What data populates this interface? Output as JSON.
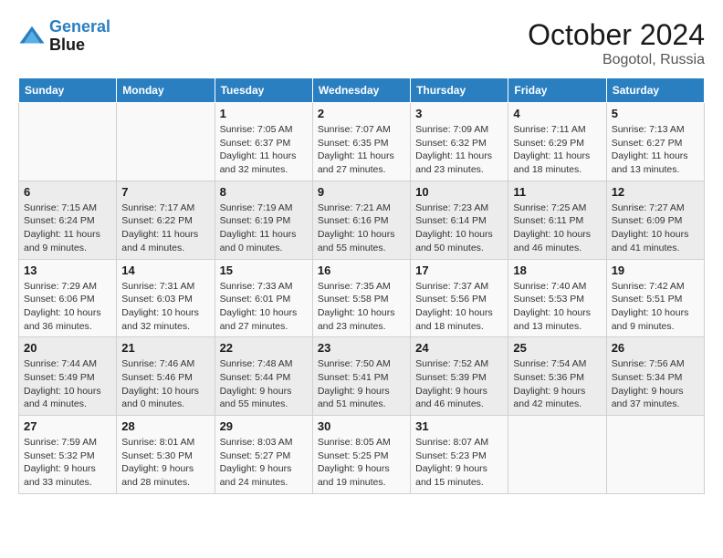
{
  "header": {
    "logo_line1": "General",
    "logo_line2": "Blue",
    "month": "October 2024",
    "location": "Bogotol, Russia"
  },
  "weekdays": [
    "Sunday",
    "Monday",
    "Tuesday",
    "Wednesday",
    "Thursday",
    "Friday",
    "Saturday"
  ],
  "weeks": [
    [
      {
        "day": "",
        "info": ""
      },
      {
        "day": "",
        "info": ""
      },
      {
        "day": "1",
        "info": "Sunrise: 7:05 AM\nSunset: 6:37 PM\nDaylight: 11 hours and 32 minutes."
      },
      {
        "day": "2",
        "info": "Sunrise: 7:07 AM\nSunset: 6:35 PM\nDaylight: 11 hours and 27 minutes."
      },
      {
        "day": "3",
        "info": "Sunrise: 7:09 AM\nSunset: 6:32 PM\nDaylight: 11 hours and 23 minutes."
      },
      {
        "day": "4",
        "info": "Sunrise: 7:11 AM\nSunset: 6:29 PM\nDaylight: 11 hours and 18 minutes."
      },
      {
        "day": "5",
        "info": "Sunrise: 7:13 AM\nSunset: 6:27 PM\nDaylight: 11 hours and 13 minutes."
      }
    ],
    [
      {
        "day": "6",
        "info": "Sunrise: 7:15 AM\nSunset: 6:24 PM\nDaylight: 11 hours and 9 minutes."
      },
      {
        "day": "7",
        "info": "Sunrise: 7:17 AM\nSunset: 6:22 PM\nDaylight: 11 hours and 4 minutes."
      },
      {
        "day": "8",
        "info": "Sunrise: 7:19 AM\nSunset: 6:19 PM\nDaylight: 11 hours and 0 minutes."
      },
      {
        "day": "9",
        "info": "Sunrise: 7:21 AM\nSunset: 6:16 PM\nDaylight: 10 hours and 55 minutes."
      },
      {
        "day": "10",
        "info": "Sunrise: 7:23 AM\nSunset: 6:14 PM\nDaylight: 10 hours and 50 minutes."
      },
      {
        "day": "11",
        "info": "Sunrise: 7:25 AM\nSunset: 6:11 PM\nDaylight: 10 hours and 46 minutes."
      },
      {
        "day": "12",
        "info": "Sunrise: 7:27 AM\nSunset: 6:09 PM\nDaylight: 10 hours and 41 minutes."
      }
    ],
    [
      {
        "day": "13",
        "info": "Sunrise: 7:29 AM\nSunset: 6:06 PM\nDaylight: 10 hours and 36 minutes."
      },
      {
        "day": "14",
        "info": "Sunrise: 7:31 AM\nSunset: 6:03 PM\nDaylight: 10 hours and 32 minutes."
      },
      {
        "day": "15",
        "info": "Sunrise: 7:33 AM\nSunset: 6:01 PM\nDaylight: 10 hours and 27 minutes."
      },
      {
        "day": "16",
        "info": "Sunrise: 7:35 AM\nSunset: 5:58 PM\nDaylight: 10 hours and 23 minutes."
      },
      {
        "day": "17",
        "info": "Sunrise: 7:37 AM\nSunset: 5:56 PM\nDaylight: 10 hours and 18 minutes."
      },
      {
        "day": "18",
        "info": "Sunrise: 7:40 AM\nSunset: 5:53 PM\nDaylight: 10 hours and 13 minutes."
      },
      {
        "day": "19",
        "info": "Sunrise: 7:42 AM\nSunset: 5:51 PM\nDaylight: 10 hours and 9 minutes."
      }
    ],
    [
      {
        "day": "20",
        "info": "Sunrise: 7:44 AM\nSunset: 5:49 PM\nDaylight: 10 hours and 4 minutes."
      },
      {
        "day": "21",
        "info": "Sunrise: 7:46 AM\nSunset: 5:46 PM\nDaylight: 10 hours and 0 minutes."
      },
      {
        "day": "22",
        "info": "Sunrise: 7:48 AM\nSunset: 5:44 PM\nDaylight: 9 hours and 55 minutes."
      },
      {
        "day": "23",
        "info": "Sunrise: 7:50 AM\nSunset: 5:41 PM\nDaylight: 9 hours and 51 minutes."
      },
      {
        "day": "24",
        "info": "Sunrise: 7:52 AM\nSunset: 5:39 PM\nDaylight: 9 hours and 46 minutes."
      },
      {
        "day": "25",
        "info": "Sunrise: 7:54 AM\nSunset: 5:36 PM\nDaylight: 9 hours and 42 minutes."
      },
      {
        "day": "26",
        "info": "Sunrise: 7:56 AM\nSunset: 5:34 PM\nDaylight: 9 hours and 37 minutes."
      }
    ],
    [
      {
        "day": "27",
        "info": "Sunrise: 7:59 AM\nSunset: 5:32 PM\nDaylight: 9 hours and 33 minutes."
      },
      {
        "day": "28",
        "info": "Sunrise: 8:01 AM\nSunset: 5:30 PM\nDaylight: 9 hours and 28 minutes."
      },
      {
        "day": "29",
        "info": "Sunrise: 8:03 AM\nSunset: 5:27 PM\nDaylight: 9 hours and 24 minutes."
      },
      {
        "day": "30",
        "info": "Sunrise: 8:05 AM\nSunset: 5:25 PM\nDaylight: 9 hours and 19 minutes."
      },
      {
        "day": "31",
        "info": "Sunrise: 8:07 AM\nSunset: 5:23 PM\nDaylight: 9 hours and 15 minutes."
      },
      {
        "day": "",
        "info": ""
      },
      {
        "day": "",
        "info": ""
      }
    ]
  ]
}
